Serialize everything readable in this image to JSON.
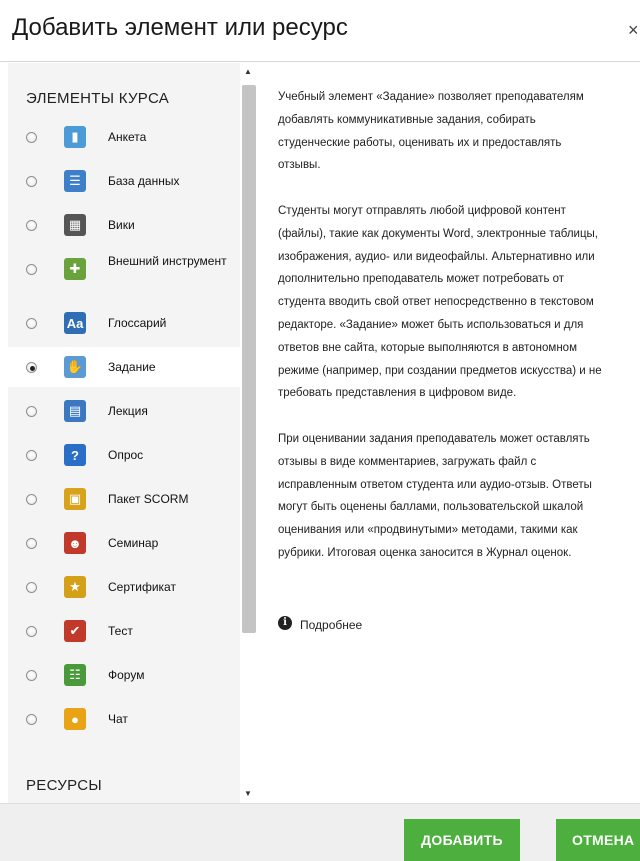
{
  "dialog": {
    "title": "Добавить элемент или ресурс",
    "close_glyph": "×"
  },
  "sections": {
    "activities": "ЭЛЕМЕНТЫ КУРСА",
    "resources": "РЕСУРСЫ"
  },
  "modules": [
    {
      "label": "Анкета",
      "icon": "feedback-icon",
      "color": "#4c9ad6",
      "selected": false
    },
    {
      "label": "База данных",
      "icon": "database-icon",
      "color": "#3d7fc9",
      "selected": false
    },
    {
      "label": "Вики",
      "icon": "wiki-icon",
      "color": "#555555",
      "selected": false
    },
    {
      "label": "Внешний инструмент",
      "icon": "external-tool-icon",
      "color": "#6aa33c",
      "selected": false
    },
    {
      "label": "Глоссарий",
      "icon": "glossary-icon",
      "color": "#2f6db5",
      "selected": false
    },
    {
      "label": "Задание",
      "icon": "assignment-icon",
      "color": "#5b9bd5",
      "selected": true
    },
    {
      "label": "Лекция",
      "icon": "lesson-icon",
      "color": "#3b78c2",
      "selected": false
    },
    {
      "label": "Опрос",
      "icon": "question-icon",
      "color": "#2a6fc7",
      "selected": false
    },
    {
      "label": "Пакет SCORM",
      "icon": "scorm-icon",
      "color": "#d9a21b",
      "selected": false
    },
    {
      "label": "Семинар",
      "icon": "workshop-icon",
      "color": "#c0392b",
      "selected": false
    },
    {
      "label": "Сертификат",
      "icon": "certificate-icon",
      "color": "#d4a017",
      "selected": false
    },
    {
      "label": "Тест",
      "icon": "quiz-icon",
      "color": "#c0392b",
      "selected": false
    },
    {
      "label": "Форум",
      "icon": "forum-icon",
      "color": "#4a9a3b",
      "selected": false
    },
    {
      "label": "Чат",
      "icon": "chat-icon",
      "color": "#e8a317",
      "selected": false
    }
  ],
  "description": {
    "lines": [
      "Учебный элемент «Задание» позволяет преподавателям",
      "добавлять коммуникативные задания, собирать",
      "студенческие работы, оценивать их и предоставлять",
      "отзывы.",
      "",
      "Студенты могут отправлять любой цифровой контент",
      "(файлы), такие как документы Word, электронные таблицы,",
      "изображения, аудио- или видеофайлы. Альтернативно или",
      "дополнительно преподаватель может потребовать от",
      "студента вводить свой ответ непосредственно в текстовом",
      "редакторе. «Задание» может быть использоваться и для",
      "ответов вне сайта, которые выполняются в автономном",
      "режиме (например, при создании предметов искусства) и не",
      "требовать представления в цифровом виде.",
      "",
      "При оценивании задания преподаватель может оставлять",
      "отзывы в виде комментариев, загружать файл с",
      "исправленным ответом студента или аудио-отзыв. Ответы",
      "могут быть оценены баллами, пользовательской шкалой",
      "оценивания или «продвинутыми» методами, такими как",
      "рубрики. Итоговая оценка заносится в Журнал оценок."
    ],
    "more_link": "Подробнее"
  },
  "buttons": {
    "add": "ДОБАВИТЬ",
    "cancel": "ОТМЕНА"
  }
}
